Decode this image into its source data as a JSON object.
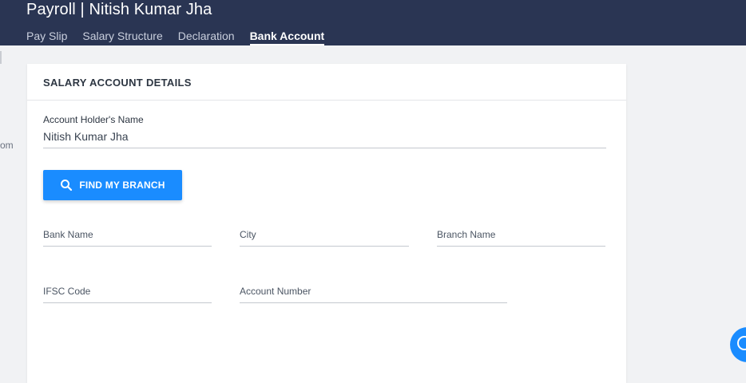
{
  "header": {
    "title": "Payroll | Nitish Kumar Jha",
    "tabs": [
      {
        "label": "Pay Slip",
        "active": false
      },
      {
        "label": "Salary Structure",
        "active": false
      },
      {
        "label": "Declaration",
        "active": false
      },
      {
        "label": "Bank Account",
        "active": true
      }
    ]
  },
  "left_fragment": "om",
  "card": {
    "title": "SALARY ACCOUNT DETAILS",
    "account_holder": {
      "label": "Account Holder's Name",
      "value": "Nitish Kumar Jha"
    },
    "find_branch_label": "FIND MY BRANCH",
    "fields": {
      "bank_name": "Bank Name",
      "city": "City",
      "branch_name": "Branch Name",
      "ifsc_code": "IFSC Code",
      "account_number": "Account Number"
    }
  },
  "icons": {
    "find": "search-icon",
    "help": "help-icon"
  },
  "colors": {
    "header_bg": "#2a3553",
    "accent": "#1a8cff"
  }
}
